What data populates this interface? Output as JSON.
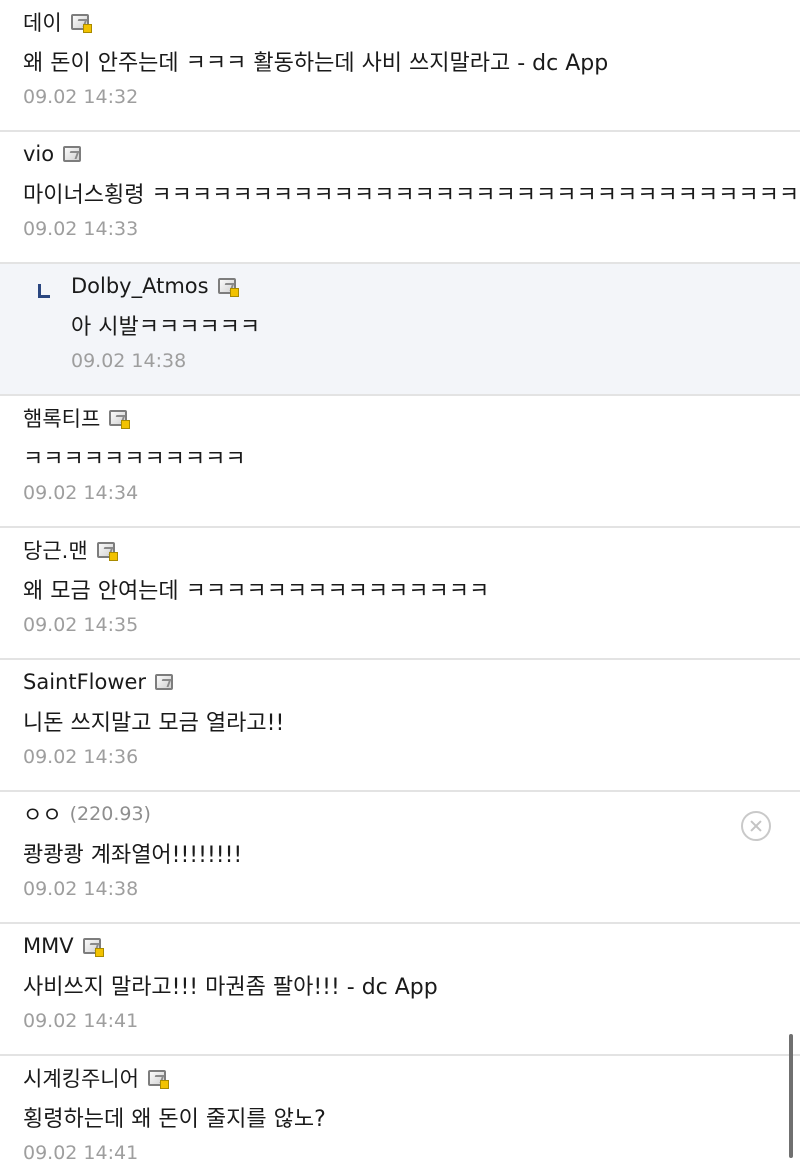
{
  "comments": [
    {
      "author": "데이",
      "text": "왜 돈이 안주는데 ㅋㅋㅋ 활동하는데 사비 쓰지말라고 - dc App",
      "time": "09.02 14:32"
    },
    {
      "author": "vio",
      "text": "마이너스횡령 ㅋㅋㅋㅋㅋㅋㅋㅋㅋㅋㅋㅋㅋㅋㅋㅋㅋㅋㅋㅋㅋㅋㅋㅋㅋㅋㅋㅋㅋㅋㅋㅋㅋㅋ",
      "time": "09.02 14:33"
    },
    {
      "author": "Dolby_Atmos",
      "text": "아 시발ㅋㅋㅋㅋㅋㅋ",
      "time": "09.02 14:38"
    },
    {
      "author": "햄록티프",
      "text": "ㅋㅋㅋㅋㅋㅋㅋㅋㅋㅋㅋ",
      "time": "09.02 14:34"
    },
    {
      "author": "당근.맨",
      "text": "왜 모금 안여는데 ㅋㅋㅋㅋㅋㅋㅋㅋㅋㅋㅋㅋㅋㅋㅋ",
      "time": "09.02 14:35"
    },
    {
      "author": "SaintFlower",
      "text": "니돈 쓰지말고 모금 열라고!!",
      "time": "09.02 14:36"
    },
    {
      "author": "ㅇㅇ",
      "ip": "(220.93)",
      "text": "쾅쾅쾅 계좌열어!!!!!!!!",
      "time": "09.02 14:38"
    },
    {
      "author": "MMV",
      "text": "사비쓰지 말라고!!! 마권좀 팔아!!! - dc App",
      "time": "09.02 14:41"
    },
    {
      "author": "시계킹주니어",
      "text": "횡령하는데 왜 돈이 줄지를 않노?",
      "time": "09.02 14:41"
    }
  ]
}
